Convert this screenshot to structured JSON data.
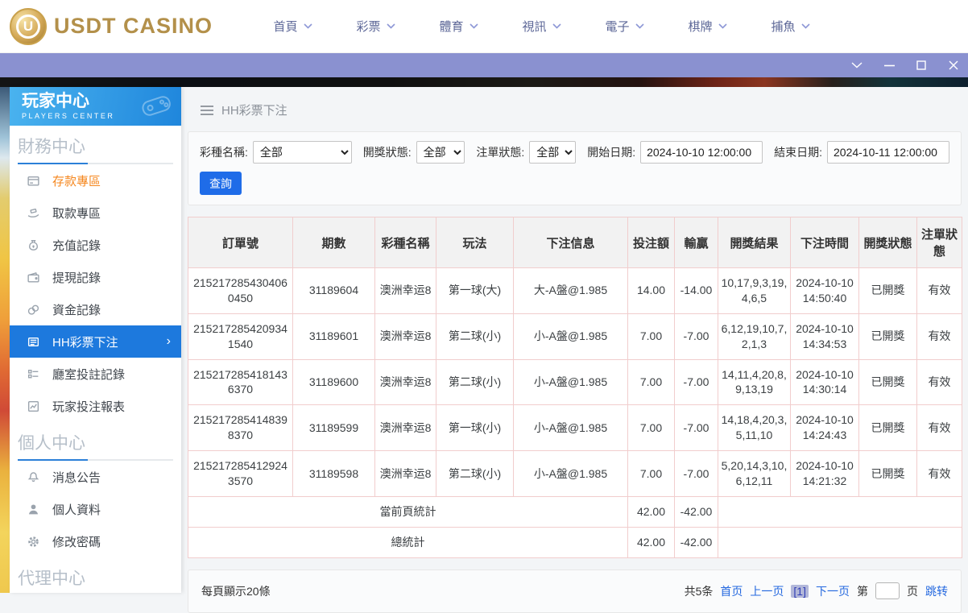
{
  "topnav": {
    "logo_text": "USDT CASINO",
    "logo_monogram": "U",
    "items": [
      {
        "label": "首頁"
      },
      {
        "label": "彩票"
      },
      {
        "label": "體育"
      },
      {
        "label": "視訊"
      },
      {
        "label": "電子"
      },
      {
        "label": "棋牌"
      },
      {
        "label": "捕魚"
      }
    ]
  },
  "sidebar": {
    "title": "玩家中心",
    "subtitle": "PLAYERS CENTER",
    "sections": [
      {
        "title": "財務中心",
        "items": [
          {
            "label": "存款專區",
            "icon": "deposit-card-icon",
            "state": "highlight"
          },
          {
            "label": "取款專區",
            "icon": "withdraw-hand-icon",
            "state": ""
          },
          {
            "label": "充值記錄",
            "icon": "moneybag-icon",
            "state": ""
          },
          {
            "label": "提現記錄",
            "icon": "wallet-icon",
            "state": ""
          },
          {
            "label": "資金記錄",
            "icon": "coins-icon",
            "state": ""
          },
          {
            "label": "HH彩票下注",
            "icon": "ticket-list-icon",
            "state": "active"
          },
          {
            "label": "廳室投註記錄",
            "icon": "clipboard-icon",
            "state": ""
          },
          {
            "label": "玩家投注報表",
            "icon": "report-chart-icon",
            "state": ""
          }
        ]
      },
      {
        "title": "個人中心",
        "items": [
          {
            "label": "消息公告",
            "icon": "bell-icon",
            "state": ""
          },
          {
            "label": "個人資料",
            "icon": "user-icon",
            "state": ""
          },
          {
            "label": "修改密碼",
            "icon": "gear-icon",
            "state": ""
          }
        ]
      },
      {
        "title": "代理中心",
        "items": []
      }
    ]
  },
  "breadcrumb": {
    "title": "HH彩票下注"
  },
  "filters": {
    "lottery_label": "彩種名稱:",
    "lottery_value": "全部",
    "draw_status_label": "開獎狀態:",
    "draw_status_value": "全部",
    "order_status_label": "注單狀態:",
    "order_status_value": "全部",
    "start_label": "開始日期:",
    "start_value": "2024-10-10 12:00:00",
    "end_label": "結束日期:",
    "end_value": "2024-10-11 12:00:00",
    "search_label": "查詢"
  },
  "table": {
    "headers": [
      "訂單號",
      "期數",
      "彩種名稱",
      "玩法",
      "下注信息",
      "投注額",
      "輸贏",
      "開獎結果",
      "下注時間",
      "開獎狀態",
      "注單狀態"
    ],
    "rows": [
      [
        "2152172854304060450",
        "31189604",
        "澳洲幸运8",
        "第一球(大)",
        "大-A盤@1.985",
        "14.00",
        "-14.00",
        "10,17,9,3,19,4,6,5",
        "2024-10-10 14:50:40",
        "已開獎",
        "有效"
      ],
      [
        "2152172854209341540",
        "31189601",
        "澳洲幸运8",
        "第二球(小)",
        "小-A盤@1.985",
        "7.00",
        "-7.00",
        "6,12,19,10,7,2,1,3",
        "2024-10-10 14:34:53",
        "已開獎",
        "有效"
      ],
      [
        "2152172854181436370",
        "31189600",
        "澳洲幸运8",
        "第二球(小)",
        "小-A盤@1.985",
        "7.00",
        "-7.00",
        "14,11,4,20,8,9,13,19",
        "2024-10-10 14:30:14",
        "已開獎",
        "有效"
      ],
      [
        "2152172854148398370",
        "31189599",
        "澳洲幸运8",
        "第一球(小)",
        "小-A盤@1.985",
        "7.00",
        "-7.00",
        "14,18,4,20,3,5,11,10",
        "2024-10-10 14:24:43",
        "已開獎",
        "有效"
      ],
      [
        "2152172854129243570",
        "31189598",
        "澳洲幸运8",
        "第二球(小)",
        "小-A盤@1.985",
        "7.00",
        "-7.00",
        "5,20,14,3,10,6,12,11",
        "2024-10-10 14:21:32",
        "已開獎",
        "有效"
      ]
    ],
    "summary": [
      {
        "label": "當前頁統計",
        "bet": "42.00",
        "winloss": "-42.00"
      },
      {
        "label": "總統計",
        "bet": "42.00",
        "winloss": "-42.00"
      }
    ]
  },
  "pagination": {
    "page_size_text": "每頁顯示20條",
    "total_text": "共5条",
    "first": "首页",
    "prev": "上一页",
    "current": "[1]",
    "next": "下一页",
    "jump_prefix": "第",
    "jump_suffix": "页",
    "jump_action": "跳转",
    "jump_value": ""
  }
}
